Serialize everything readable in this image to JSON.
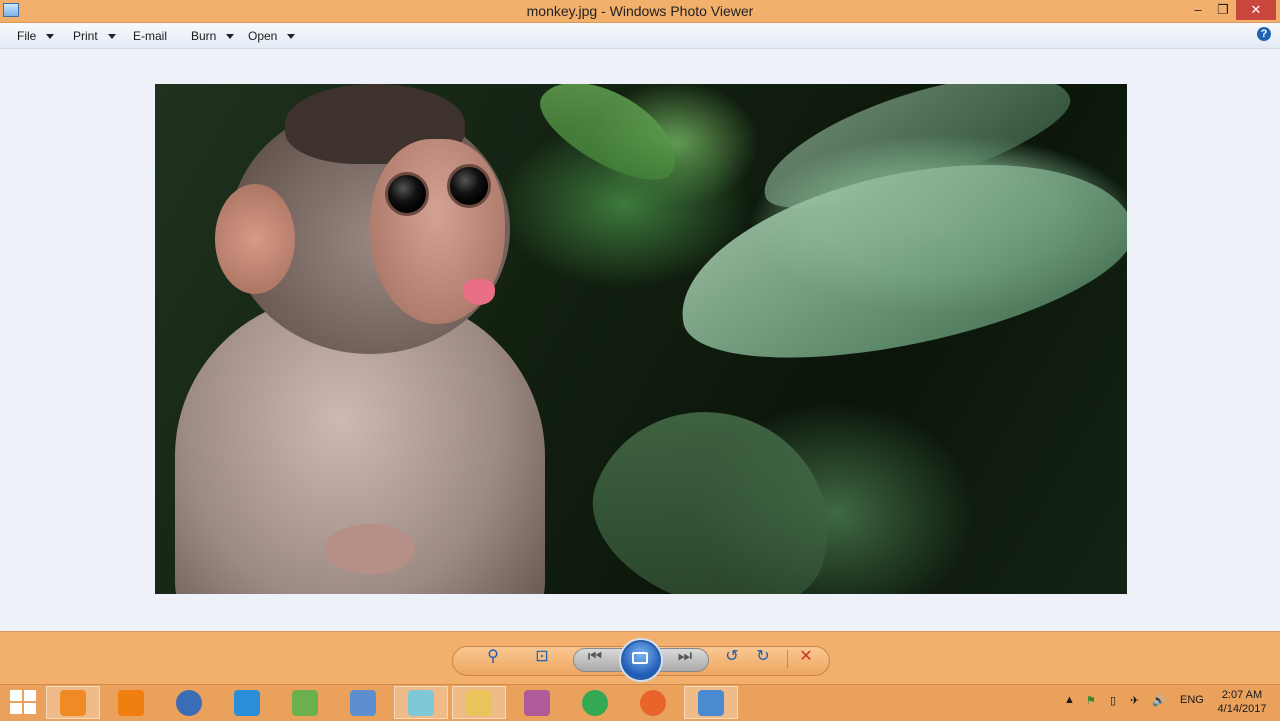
{
  "window": {
    "title": "monkey.jpg - Windows Photo Viewer",
    "minimize_glyph": "–",
    "maximize_glyph": "❐",
    "close_glyph": "✕"
  },
  "menubar": {
    "items": [
      {
        "label": "File",
        "has_dropdown": true
      },
      {
        "label": "Print",
        "has_dropdown": true
      },
      {
        "label": "E-mail",
        "has_dropdown": false
      },
      {
        "label": "Burn",
        "has_dropdown": true
      },
      {
        "label": "Open",
        "has_dropdown": true
      }
    ],
    "help_glyph": "?"
  },
  "photo": {
    "subject": "baby monkey sticking out tongue in front of green leaves"
  },
  "controls": {
    "zoom_glyph": "⚲",
    "actual_size_glyph": "⊡",
    "prev_glyph": "⏮",
    "next_glyph": "⏭",
    "rotate_ccw_glyph": "↺",
    "rotate_cw_glyph": "↻",
    "delete_glyph": "✕"
  },
  "taskbar": {
    "items": [
      {
        "name": "windows-media-player",
        "color": "#f08a24",
        "active": true
      },
      {
        "name": "vlc",
        "color": "#f07f10",
        "active": false
      },
      {
        "name": "media-center",
        "color": "#3a6db5",
        "active": false
      },
      {
        "name": "screenshot-tool",
        "color": "#2a8fd8",
        "active": false
      },
      {
        "name": "android-studio",
        "color": "#6ab04c",
        "active": false
      },
      {
        "name": "virtualbox-cube",
        "color": "#5d8fd0",
        "active": false
      },
      {
        "name": "notes",
        "color": "#7fc8d8",
        "active": true
      },
      {
        "name": "file-explorer",
        "color": "#e8c45a",
        "active": true
      },
      {
        "name": "paint",
        "color": "#b05a9a",
        "active": false
      },
      {
        "name": "chrome",
        "color": "#34a853",
        "active": false
      },
      {
        "name": "firefox",
        "color": "#e8642a",
        "active": false
      },
      {
        "name": "photo-viewer",
        "color": "#4a8ad0",
        "active": true
      }
    ],
    "tray": {
      "language": "ENG",
      "time": "2:07 AM",
      "date": "4/14/2017"
    }
  },
  "colors": {
    "accent_orange": "#f2b06c",
    "viewer_bg": "#eef2f8",
    "control_blue": "#1f5fb0",
    "delete_red": "#c8352b"
  }
}
